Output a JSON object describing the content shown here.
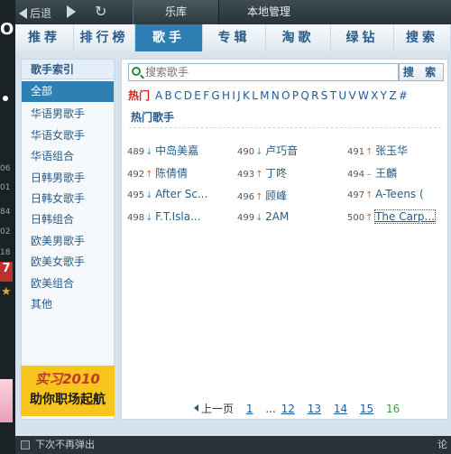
{
  "top_nav": {
    "back_label": "后退",
    "tabs": [
      "乐库",
      "本地管理"
    ]
  },
  "categories": [
    "推荐",
    "排行榜",
    "歌手",
    "专辑",
    "淘歌",
    "绿钻",
    "搜索"
  ],
  "sidebar": {
    "title": "歌手索引",
    "items": [
      "全部",
      "华语男歌手",
      "华语女歌手",
      "华语组合",
      "日韩男歌手",
      "日韩女歌手",
      "日韩组合",
      "欧美男歌手",
      "欧美女歌手",
      "欧美组合",
      "其他"
    ]
  },
  "ad": {
    "line1": "实习2010",
    "line2": "助你职场起航"
  },
  "search": {
    "placeholder": "搜索歌手",
    "button": "搜 索"
  },
  "alphabet": {
    "hot": "热门",
    "letters": [
      "A",
      "B",
      "C",
      "D",
      "E",
      "F",
      "G",
      "H",
      "I",
      "J",
      "K",
      "L",
      "M",
      "N",
      "O",
      "P",
      "Q",
      "R",
      "S",
      "T",
      "U",
      "V",
      "W",
      "X",
      "Y",
      "Z",
      "#"
    ]
  },
  "section_title": "热门歌手",
  "singers": [
    [
      {
        "rank": "489",
        "trend": "down",
        "name": "中岛美嘉"
      },
      {
        "rank": "490",
        "trend": "down",
        "name": "卢巧音"
      },
      {
        "rank": "491",
        "trend": "up",
        "name": "张玉华"
      }
    ],
    [
      {
        "rank": "492",
        "trend": "up",
        "name": "陈倩倩"
      },
      {
        "rank": "493",
        "trend": "up",
        "name": "丁咚"
      },
      {
        "rank": "494",
        "trend": "flat",
        "name": "王麟"
      }
    ],
    [
      {
        "rank": "495",
        "trend": "down",
        "name": "After Sc..."
      },
      {
        "rank": "496",
        "trend": "up",
        "name": "顾峰"
      },
      {
        "rank": "497",
        "trend": "up",
        "name": "A-Teens ("
      }
    ],
    [
      {
        "rank": "498",
        "trend": "down",
        "name": "F.T.Isla..."
      },
      {
        "rank": "499",
        "trend": "down",
        "name": "2AM"
      },
      {
        "rank": "500",
        "trend": "up",
        "name": "The Carp..."
      }
    ]
  ],
  "pager": {
    "prev": "上一页",
    "pages": [
      "1",
      "...",
      "12",
      "13",
      "14",
      "15",
      "16"
    ],
    "current": "16"
  },
  "bottom": {
    "checkbox_label": "下次不再弹出",
    "right_text": "论"
  },
  "left_strip": {
    "numbers": [
      "06",
      "01",
      "84",
      "02",
      "18"
    ],
    "badge": "7"
  }
}
